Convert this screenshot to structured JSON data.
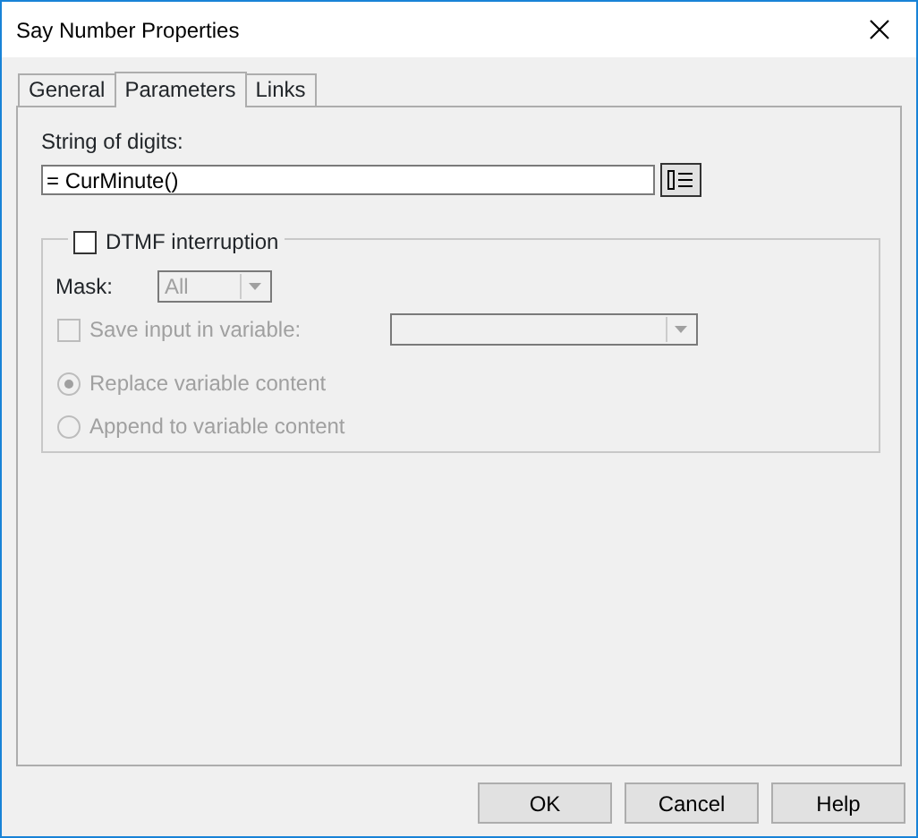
{
  "window": {
    "title": "Say Number Properties"
  },
  "tabs": [
    {
      "label": "General",
      "selected": false
    },
    {
      "label": "Parameters",
      "selected": true
    },
    {
      "label": "Links",
      "selected": false
    }
  ],
  "digits": {
    "label": "String of digits:",
    "value": "= CurMinute()"
  },
  "dtmf": {
    "label": "DTMF interruption",
    "checked": false,
    "mask": {
      "label": "Mask:",
      "value": "All",
      "disabled": true
    },
    "save_input": {
      "label": "Save input in variable:",
      "checked": false,
      "disabled": true
    },
    "options": [
      {
        "label": "Replace variable content",
        "selected": true,
        "disabled": true
      },
      {
        "label": "Append to variable content",
        "selected": false,
        "disabled": true
      }
    ]
  },
  "buttons": [
    "OK",
    "Cancel",
    "Help"
  ]
}
